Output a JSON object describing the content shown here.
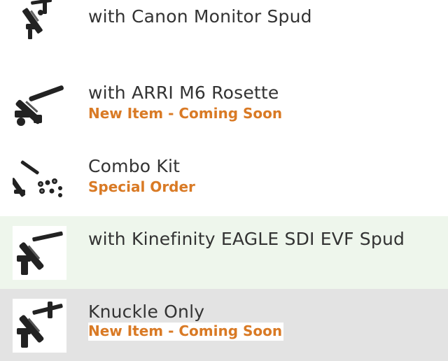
{
  "colors": {
    "title_text": "#333333",
    "status_text": "#d97a25",
    "row_hover_bg": "#eef6ec",
    "row_selected_bg": "#e3e3e3",
    "row_bg": "#ffffff"
  },
  "items": [
    {
      "title": "with Canon Monitor Spud",
      "status": "",
      "image_icon": "side-arm-icon"
    },
    {
      "title": "with ARRI M6 Rosette",
      "status": "New Item - Coming Soon",
      "image_icon": "side-arm-rosette-icon"
    },
    {
      "title": "Combo Kit",
      "status": "Special Order",
      "image_icon": "combo-kit-icon"
    },
    {
      "title": "with Kinefinity EAGLE SDI EVF Spud",
      "status": "",
      "image_icon": "side-arm-icon"
    },
    {
      "title": "Knuckle Only",
      "status": "New Item - Coming Soon",
      "image_icon": "side-arm-icon"
    }
  ]
}
